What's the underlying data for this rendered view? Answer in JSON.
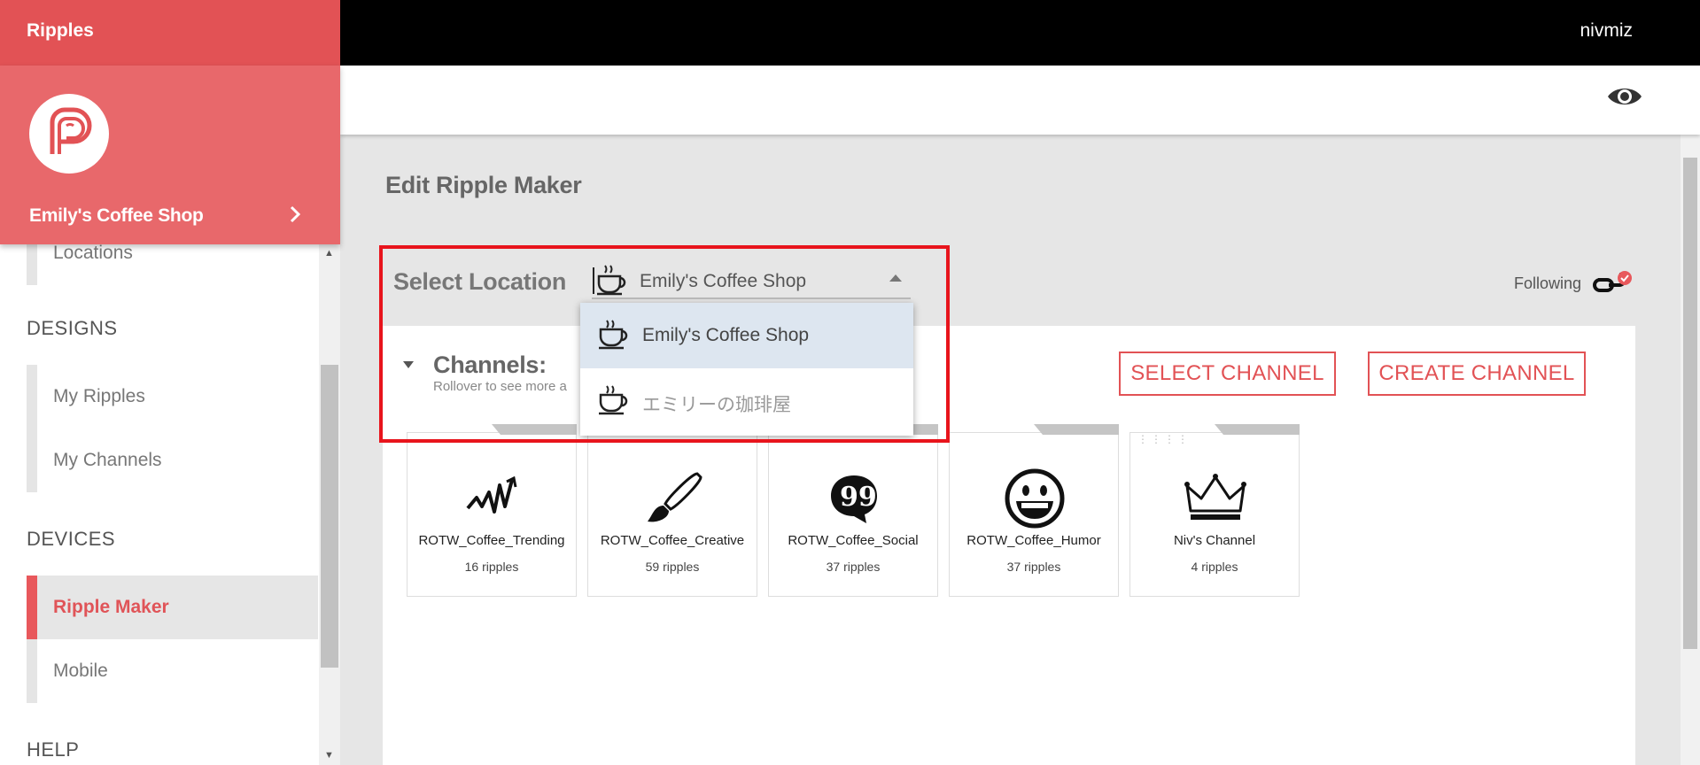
{
  "app": {
    "brand": "Ripples",
    "user": "nivmiz"
  },
  "profile": {
    "shop_name": "Emily's Coffee Shop"
  },
  "sidebar": {
    "locations_label": "Locations",
    "designs_heading": "DESIGNS",
    "designs_items": [
      {
        "label": "My Ripples"
      },
      {
        "label": "My Channels"
      }
    ],
    "devices_heading": "DEVICES",
    "devices_items": [
      {
        "label": "Ripple Maker",
        "active": true
      },
      {
        "label": "Mobile"
      }
    ],
    "help_heading": "HELP"
  },
  "page": {
    "title": "Edit Ripple Maker"
  },
  "location": {
    "label": "Select Location",
    "selected": "Emily's Coffee Shop",
    "options": [
      "Emily's Coffee Shop",
      "エミリーの珈琲屋"
    ],
    "following_label": "Following"
  },
  "channels": {
    "title": "Channels:",
    "subtitle": "Rollover to see more a",
    "select_button": "SELECT CHANNEL",
    "create_button": "CREATE CHANNEL",
    "cards": [
      {
        "name": "ROTW_Coffee_Trending",
        "count": "16 ripples",
        "icon": "trending-icon"
      },
      {
        "name": "ROTW_Coffee_Creative",
        "count": "59 ripples",
        "icon": "paintbrush-icon"
      },
      {
        "name": "ROTW_Coffee_Social",
        "count": "37 ripples",
        "icon": "quote-bubble-icon"
      },
      {
        "name": "ROTW_Coffee_Humor",
        "count": "37 ripples",
        "icon": "smiley-icon"
      },
      {
        "name": "Niv's Channel",
        "count": "4 ripples",
        "icon": "crown-icon"
      }
    ]
  },
  "colors": {
    "brand": "#e25255",
    "profile": "#e8686b",
    "highlight": "#e8141c",
    "selected_option": "#dde6f0"
  }
}
